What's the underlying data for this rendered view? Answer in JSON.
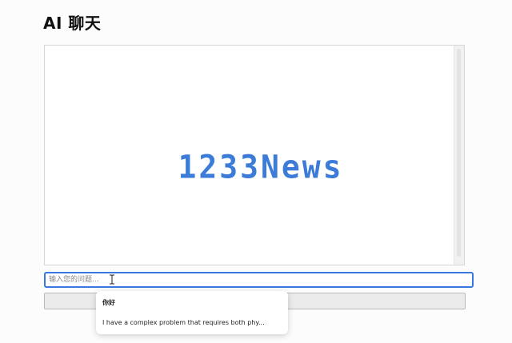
{
  "page": {
    "title": "AI 聊天"
  },
  "chat": {
    "watermark": "1233News"
  },
  "input": {
    "placeholder": "输入您的问题..."
  },
  "suggestions": [
    "你好",
    "I have a complex problem that requires both phy..."
  ],
  "colors": {
    "accent": "#3878e0",
    "watermark": "#3c7cd8"
  }
}
